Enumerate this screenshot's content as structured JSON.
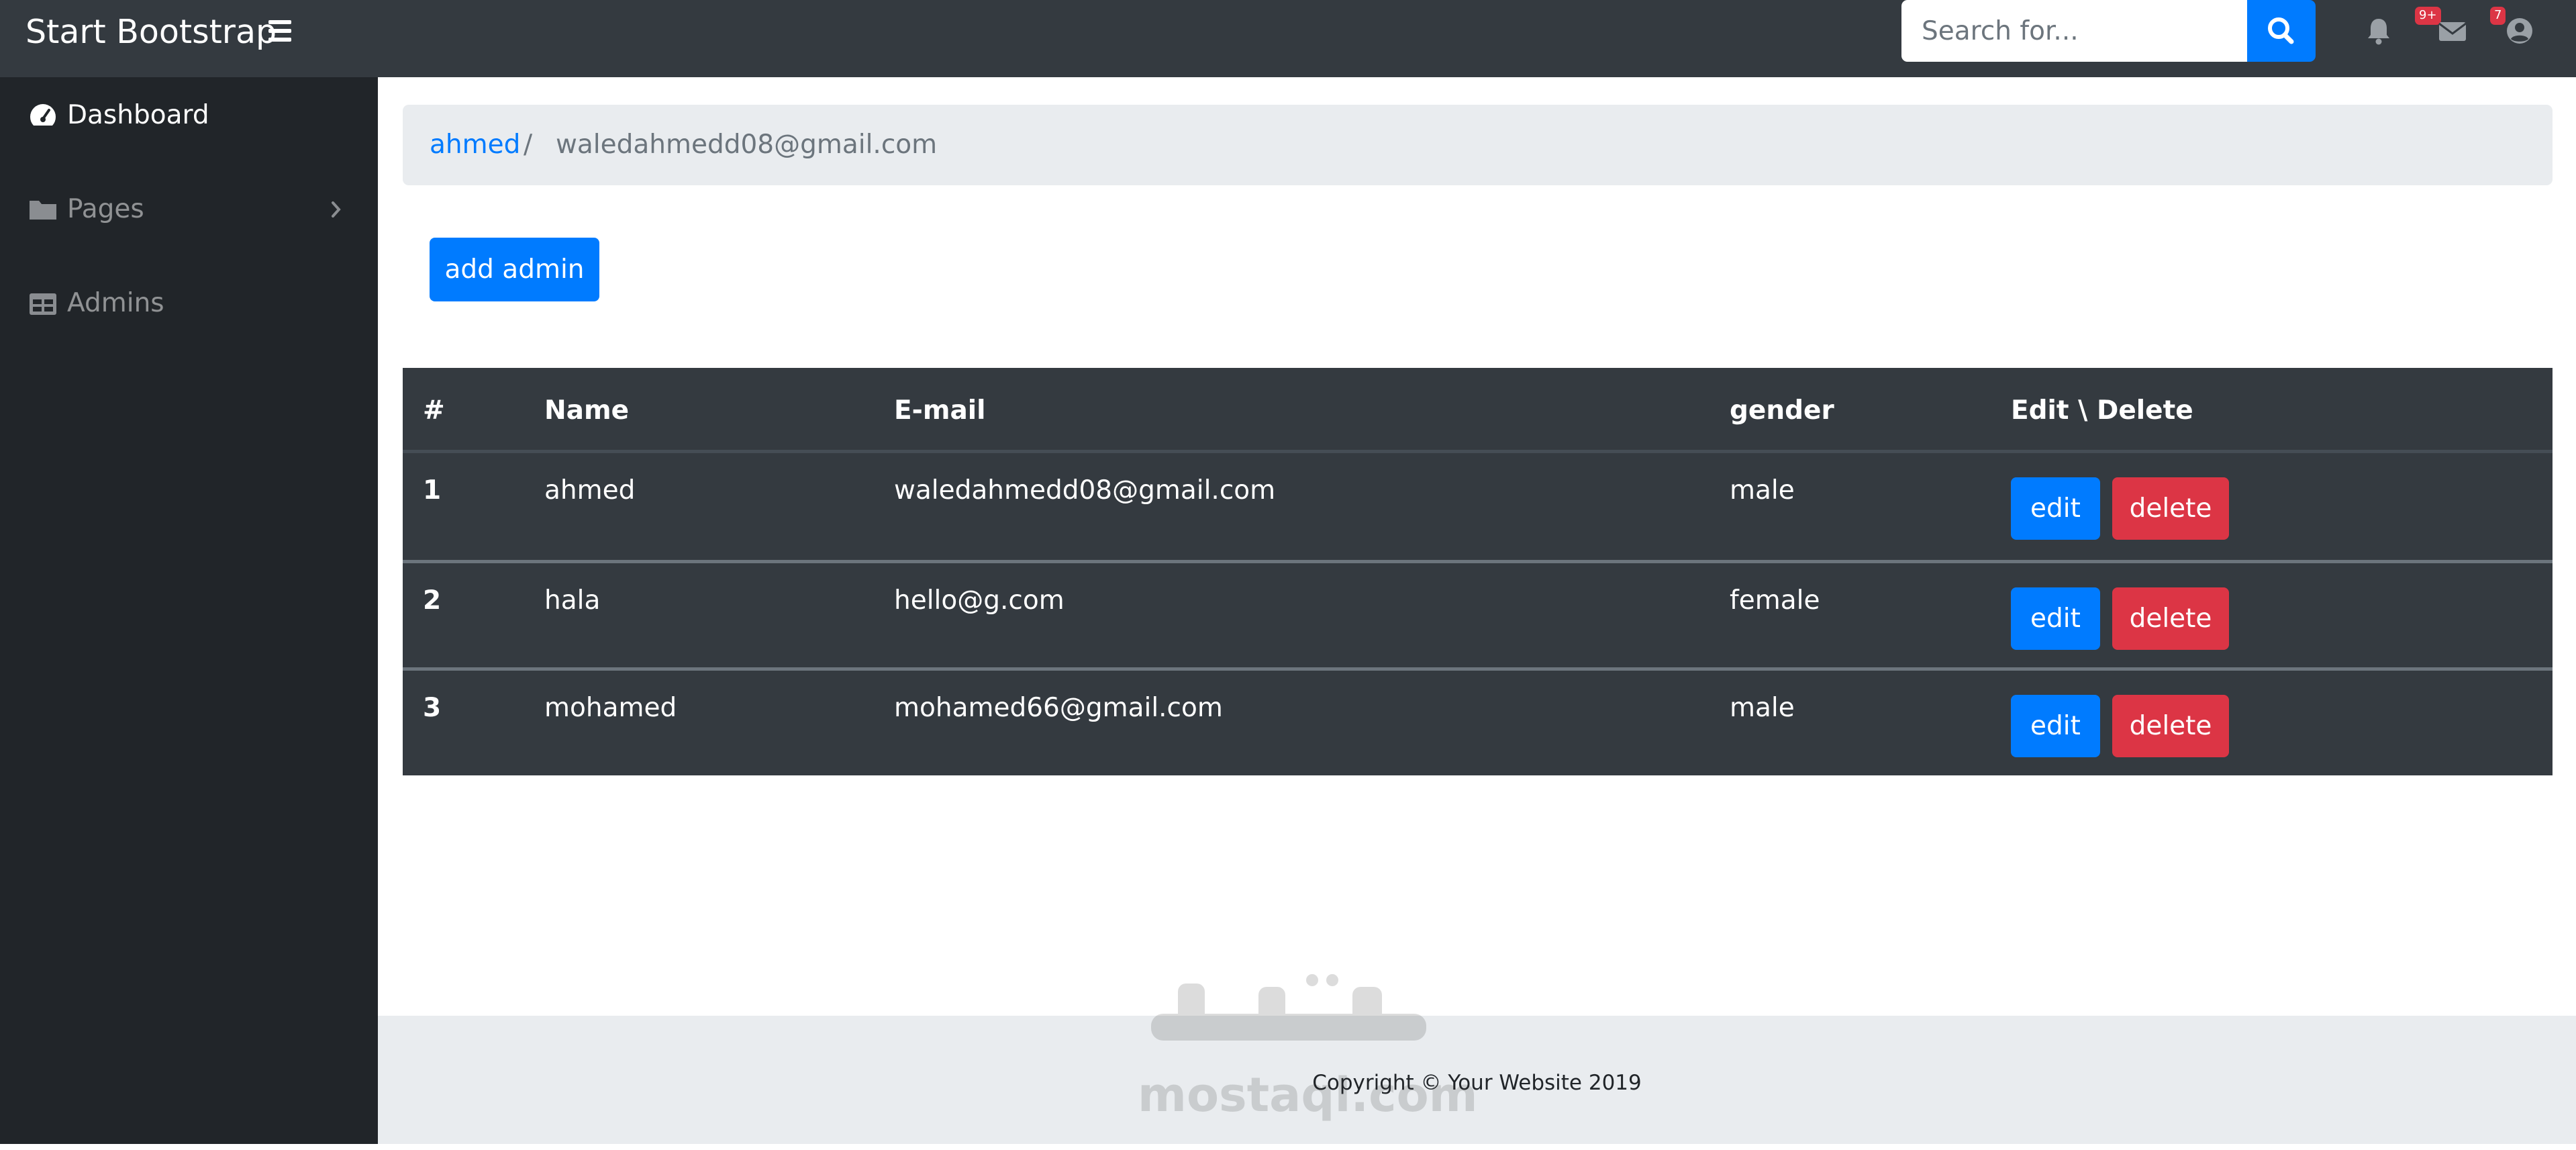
{
  "navbar": {
    "brand": "Start Bootstrap",
    "search_placeholder": "Search for...",
    "alerts_badge": "9+",
    "messages_badge": "7"
  },
  "sidebar": {
    "items": [
      {
        "label": "Dashboard",
        "icon": "tachometer-icon",
        "active": true
      },
      {
        "label": "Pages",
        "icon": "folder-icon",
        "has_submenu": true
      },
      {
        "label": "Admins",
        "icon": "table-icon"
      }
    ]
  },
  "breadcrumb": {
    "link": "ahmed",
    "separator": "/",
    "current": "waledahmedd08@gmail.com"
  },
  "main": {
    "add_button": "add admin"
  },
  "table": {
    "headers": [
      "#",
      "Name",
      "E-mail",
      "gender",
      "Edit \\ Delete"
    ],
    "rows": [
      {
        "num": "1",
        "name": "ahmed",
        "email": "waledahmedd08@gmail.com",
        "gender": "male",
        "edit": "edit",
        "delete": "delete"
      },
      {
        "num": "2",
        "name": "hala",
        "email": "hello@g.com",
        "gender": "female",
        "edit": "edit",
        "delete": "delete"
      },
      {
        "num": "3",
        "name": "mohamed",
        "email": "mohamed66@gmail.com",
        "gender": "male",
        "edit": "edit",
        "delete": "delete"
      }
    ]
  },
  "footer": {
    "copyright": "Copyright © Your Website 2019"
  },
  "watermark": {
    "text": "mostaql.com"
  },
  "colors": {
    "navbar": "#343a40",
    "sidebar": "#212529",
    "primary": "#007bff",
    "danger": "#dc3545",
    "breadcrumb_bg": "#e9ecef"
  }
}
